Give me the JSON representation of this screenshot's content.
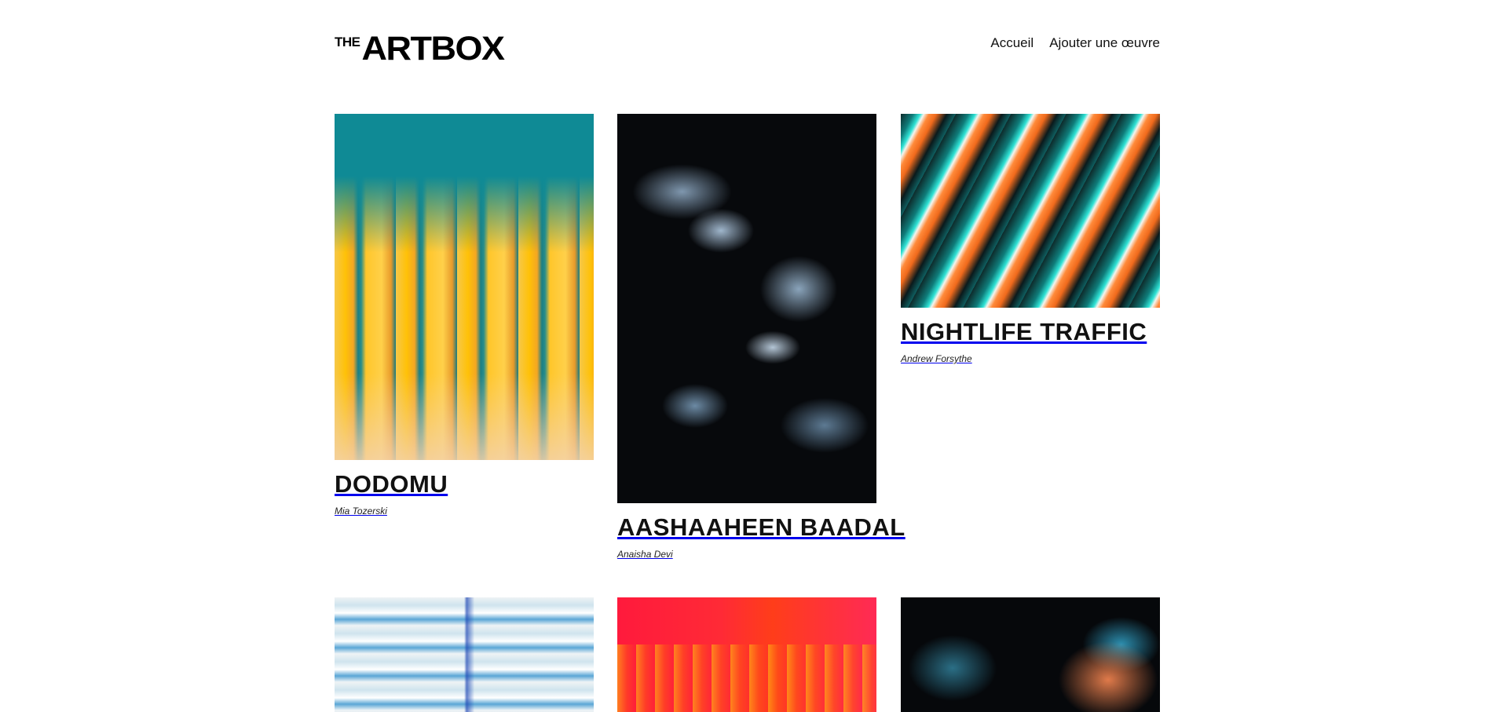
{
  "header": {
    "logo_small": "THE",
    "logo_main": "ARTBOX",
    "nav": [
      {
        "label": "Accueil"
      },
      {
        "label": "Ajouter une œuvre"
      }
    ]
  },
  "artworks": [
    {
      "title": "DODOMU",
      "artist": "Mia Tozerski"
    },
    {
      "title": "AASHAAHEEN BAADAL",
      "artist": "Anaisha Devi"
    },
    {
      "title": "NIGHTLIFE TRAFFIC",
      "artist": "Andrew Forsythe"
    },
    {
      "title": "",
      "artist": ""
    },
    {
      "title": "",
      "artist": ""
    },
    {
      "title": "",
      "artist": ""
    }
  ]
}
